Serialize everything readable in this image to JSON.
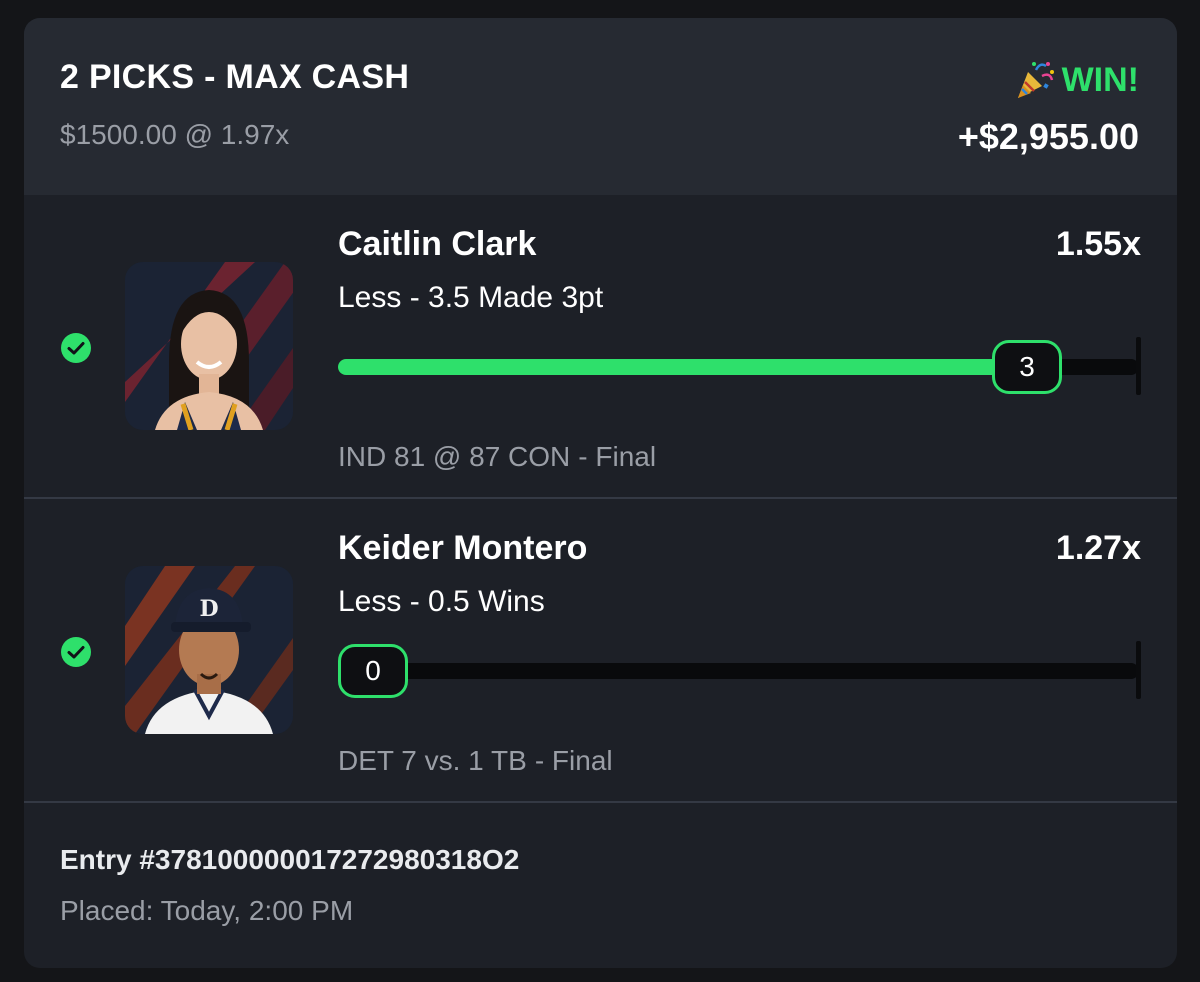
{
  "header": {
    "title": "2 PICKS - MAX CASH",
    "wager": "$1500.00 @ 1.97x",
    "result": "WIN!",
    "result_icon": "party-popper-icon",
    "payout": "+$2,955.00"
  },
  "picks": [
    {
      "player": "Caitlin Clark",
      "multiplier": "1.55x",
      "line": "Less - 3.5 Made 3pt",
      "result_value": "3",
      "progress_fraction": 0.86,
      "game": "IND 81 @ 87 CON",
      "status": "- Final",
      "check_icon": "check-circle-icon"
    },
    {
      "player": "Keider Montero",
      "multiplier": "1.27x",
      "line": "Less - 0.5 Wins",
      "result_value": "0",
      "progress_fraction": 0.0,
      "game": "DET 7 vs. 1 TB",
      "status": "- Final",
      "check_icon": "check-circle-icon"
    }
  ],
  "footer": {
    "entry": "Entry #378100000017272980318O2",
    "placed": "Placed: Today, 2:00 PM"
  },
  "colors": {
    "accent_green": "#2ee06b",
    "card_bg": "#1d2027",
    "header_bg": "#262a32",
    "muted_text": "#9a9ea6"
  }
}
